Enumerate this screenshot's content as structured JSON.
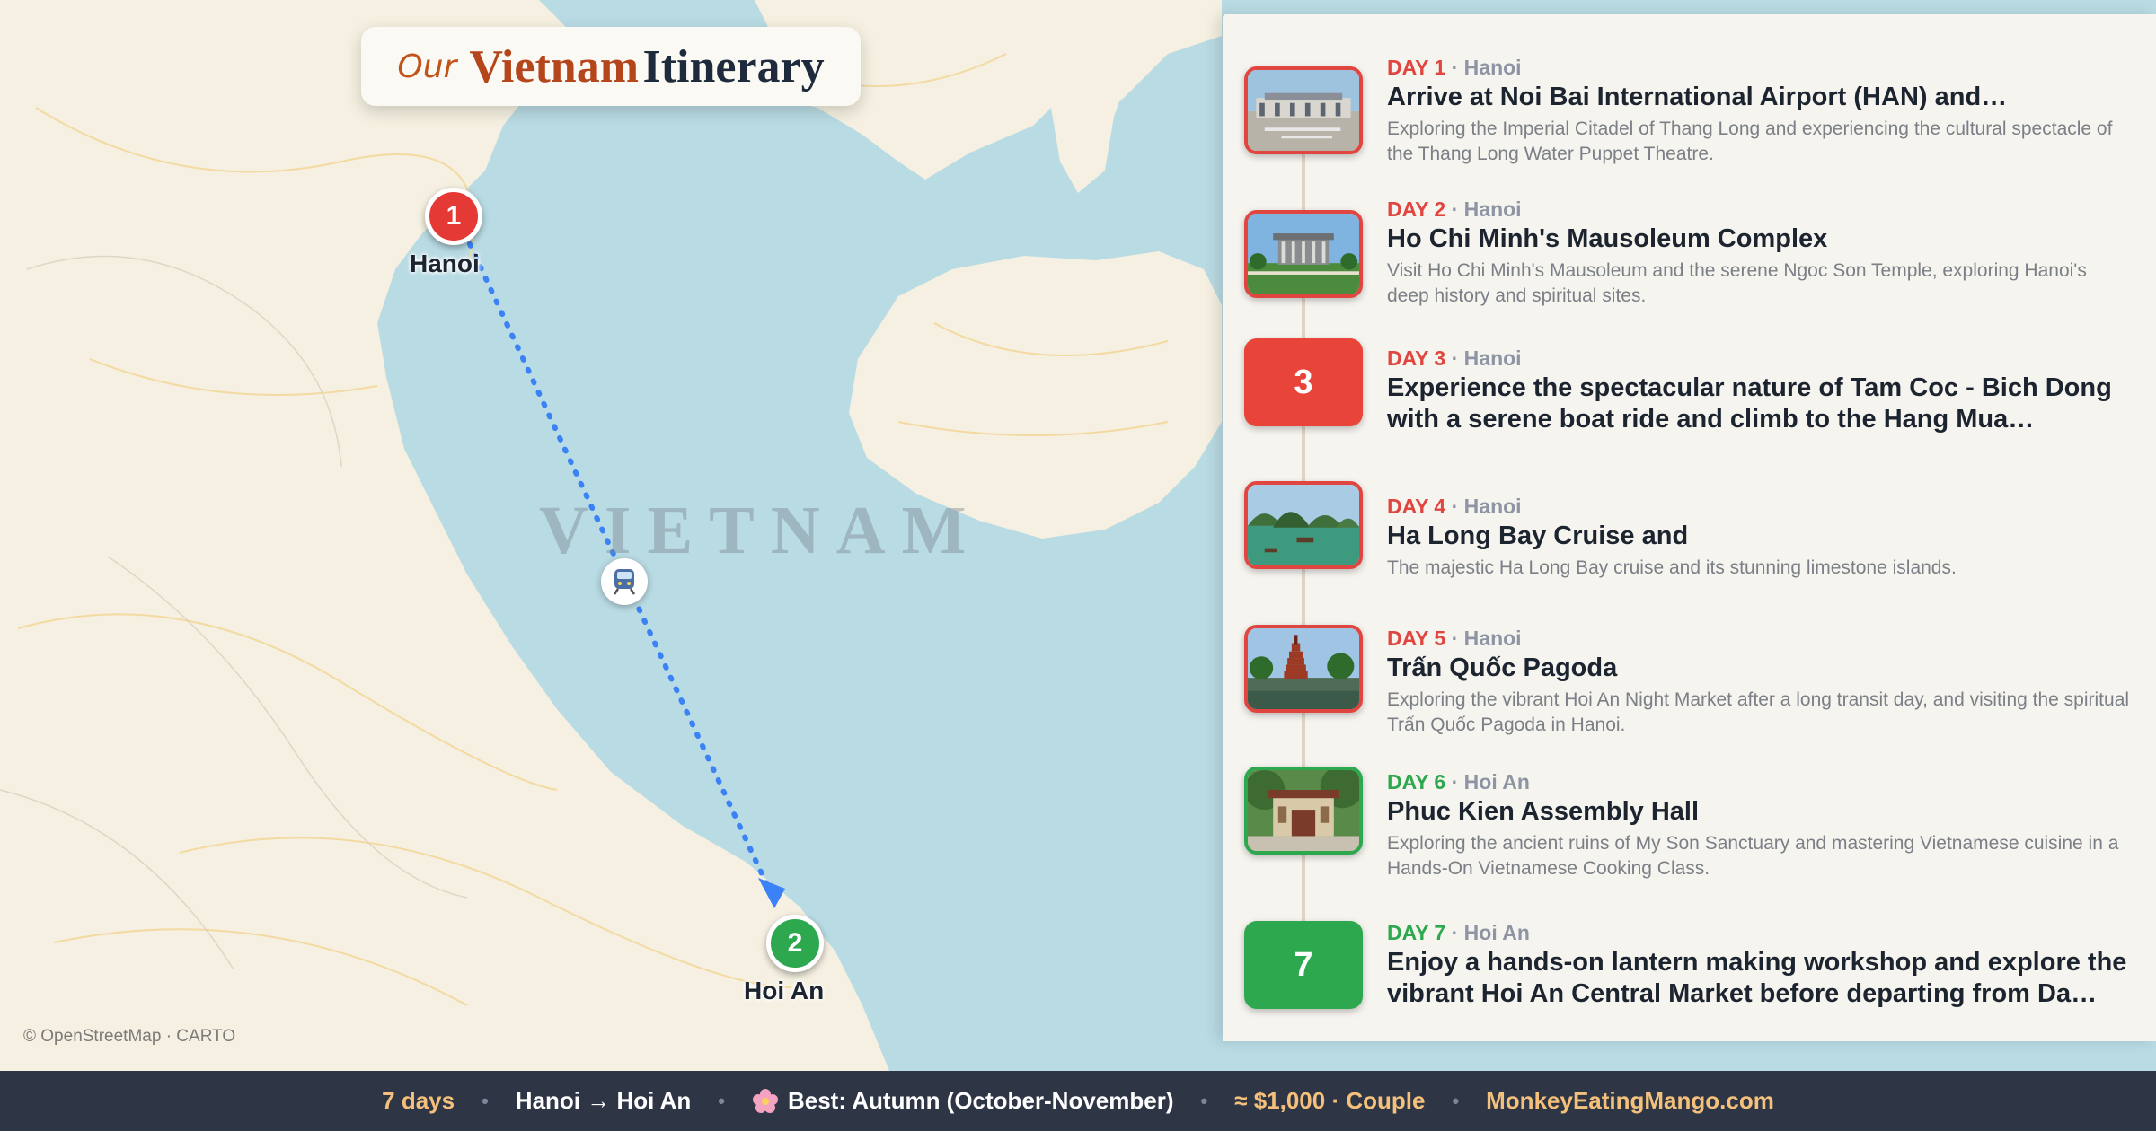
{
  "title": {
    "prefix": "Our",
    "country": "Vietnam",
    "word": "Itinerary"
  },
  "map": {
    "country_label": "VIETNAM",
    "attribution": "© OpenStreetMap · CARTO",
    "stops": [
      {
        "number": "1",
        "city": "Hanoi",
        "color": "#e53935"
      },
      {
        "number": "2",
        "city": "Hoi An",
        "color": "#2ea84f"
      }
    ],
    "route": {
      "mode": "train-icon",
      "color": "#3b82f6",
      "style": "dotted"
    }
  },
  "days": [
    {
      "label": "DAY 1",
      "city": "Hanoi",
      "title": "Arrive at Noi Bai International Airport (HAN) and…",
      "description": "Exploring the Imperial Citadel of Thang Long and experiencing the cultural spectacle of the Thang Long Water Puppet Theatre.",
      "thumb": "airport-photo",
      "accent": "#e0463f"
    },
    {
      "label": "DAY 2",
      "city": "Hanoi",
      "title": "Ho Chi Minh's Mausoleum Complex",
      "description": "Visit Ho Chi Minh's Mausoleum and the serene Ngoc Son Temple, exploring Hanoi's deep history and spiritual sites.",
      "thumb": "mausoleum-photo",
      "accent": "#e0463f"
    },
    {
      "label": "DAY 3",
      "city": "Hanoi",
      "number": "3",
      "title": "Experience the spectacular nature of Tam Coc - Bich Dong with a serene boat ride and climb to the Hang Mua Viewpoi…",
      "description": "",
      "thumb": "number-tile",
      "accent": "#e8443a"
    },
    {
      "label": "DAY 4",
      "city": "Hanoi",
      "title": "Ha Long Bay Cruise and",
      "description": "The majestic Ha Long Bay cruise and its stunning limestone islands.",
      "thumb": "halong-bay-photo",
      "accent": "#e0463f"
    },
    {
      "label": "DAY 5",
      "city": "Hanoi",
      "title": "Trấn Quốc Pagoda",
      "description": "Exploring the vibrant Hoi An Night Market after a long transit day, and visiting the spiritual Trấn Quốc Pagoda in Hanoi.",
      "thumb": "pagoda-photo",
      "accent": "#e0463f"
    },
    {
      "label": "DAY 6",
      "city": "Hoi An",
      "title": "Phuc Kien Assembly Hall",
      "description": "Exploring the ancient ruins of My Son Sanctuary and mastering Vietnamese cuisine in a Hands-On Vietnamese Cooking Class.",
      "thumb": "assembly-hall-photo",
      "accent": "#2ea84f"
    },
    {
      "label": "DAY 7",
      "city": "Hoi An",
      "number": "7",
      "title": "Enjoy a hands-on lantern making workshop and explore the vibrant Hoi An Central Market before departing from Da…",
      "description": "",
      "thumb": "number-tile",
      "accent": "#2ea84f"
    }
  ],
  "footer": {
    "days": "7 days",
    "route": "Hanoi → Hoi An",
    "season": "Best: Autumn (October-November)",
    "season_icon": "flower-icon",
    "budget": "≈ $1,000 · Couple",
    "site": "MonkeyEatingMango.com",
    "separator": "•"
  }
}
